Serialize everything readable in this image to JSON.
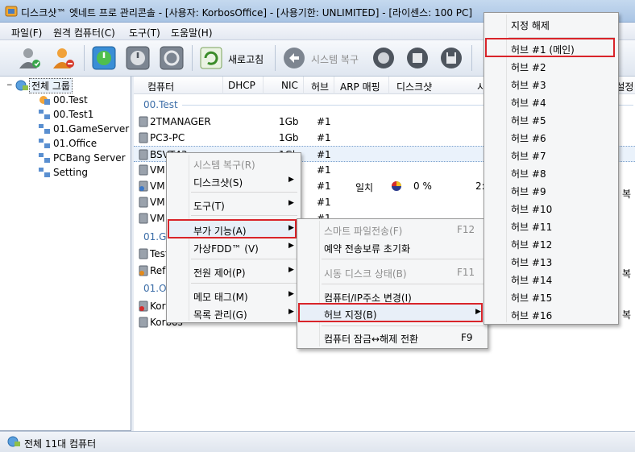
{
  "window": {
    "title": "디스크샷™ 엣네트 프로 관리콘솔 - [사용자: KorbosOffice] - [사용기한: UNLIMITED] - [라이센스: 100 PC]"
  },
  "menubar": [
    "파일(F)",
    "원격 컴퓨터(C)",
    "도구(T)",
    "도움말(H)"
  ],
  "toolbar": {
    "refresh_label": "새로고침",
    "restore_label": "시스템 복구"
  },
  "tree": {
    "root": "전체 그룹",
    "items": [
      "00.Test",
      "00.Test1",
      "01.GameServer",
      "01.Office",
      "PCBang Server",
      "Setting"
    ]
  },
  "columns": [
    "컴퓨터",
    "DHCP",
    "NIC",
    "허브",
    "ARP 매핑",
    "디스크샷",
    "시",
    "-설정"
  ],
  "groups": [
    {
      "label": "00.Test"
    },
    {
      "label": "01.Ga"
    },
    {
      "label": "01.Of"
    }
  ],
  "rows": [
    {
      "name": "2TMANAGER",
      "nic": "1Gb",
      "hub": "#1",
      "arp": "",
      "ds": ""
    },
    {
      "name": "PC3-PC",
      "nic": "1Gb",
      "hub": "#1",
      "arp": "",
      "ds": ""
    },
    {
      "name": "BSVT43",
      "nic": "1Gb",
      "hub": "#1",
      "arp": "",
      "ds": ""
    },
    {
      "name": "VM",
      "nic": "",
      "hub": "#1",
      "arp": "",
      "ds": ""
    },
    {
      "name": "VM",
      "nic": "",
      "hub": "#1",
      "arp": "일치",
      "ds": "0 %",
      "extra": "2:"
    },
    {
      "name": "VM",
      "nic": "",
      "hub": "#1",
      "arp": "",
      "ds": ""
    },
    {
      "name": "VM",
      "nic": "",
      "hub": "#1",
      "arp": "",
      "ds": ""
    },
    {
      "name": "Test",
      "nic": "",
      "hub": "",
      "arp": "",
      "ds": ""
    },
    {
      "name": "Ref",
      "nic": "",
      "hub": "",
      "arp": "",
      "ds": ""
    },
    {
      "name": "Kor",
      "nic": "",
      "hub": "",
      "arp": "",
      "ds": ""
    },
    {
      "name": "Korbos",
      "nic": "",
      "hub": "",
      "arp": "",
      "ds": ""
    }
  ],
  "right_fragments": [
    "복",
    "복",
    "복"
  ],
  "context_menu": {
    "items": [
      {
        "label": "시스템 복구(R)",
        "disabled": true,
        "submenu": false
      },
      {
        "label": "디스크샷(S)",
        "disabled": false,
        "submenu": true
      },
      {
        "label": "도구(T)",
        "disabled": false,
        "submenu": true
      },
      {
        "label": "부가 기능(A)",
        "disabled": false,
        "submenu": true
      },
      {
        "label": "가상FDD™ (V)",
        "disabled": false,
        "submenu": true
      },
      {
        "label": "전원 제어(P)",
        "disabled": false,
        "submenu": true
      },
      {
        "label": "메모 태그(M)",
        "disabled": false,
        "submenu": true
      },
      {
        "label": "목록 관리(G)",
        "disabled": false,
        "submenu": true
      }
    ]
  },
  "sub_menu": {
    "items": [
      {
        "label": "스마트 파일전송(F)",
        "shortcut": "F12",
        "disabled": true
      },
      {
        "label": "예약 전송보류 초기화",
        "shortcut": "",
        "disabled": false
      },
      {
        "label": "시동 디스크 상태(B)",
        "shortcut": "F11",
        "disabled": true
      },
      {
        "label": "컴퓨터/IP주소 변경(I)",
        "shortcut": "",
        "disabled": false
      },
      {
        "label": "허브 지정(B)",
        "shortcut": "",
        "disabled": false
      },
      {
        "label": "컴퓨터 잠금↔해제 전환",
        "shortcut": "F9",
        "disabled": false
      }
    ]
  },
  "hub_menu": {
    "items": [
      "지정 해제",
      "허브 #1 (메인)",
      "허브 #2",
      "허브 #3",
      "허브 #4",
      "허브 #5",
      "허브 #6",
      "허브 #7",
      "허브 #8",
      "허브 #9",
      "허브 #10",
      "허브 #11",
      "허브 #12",
      "허브 #13",
      "허브 #14",
      "허브 #15",
      "허브 #16"
    ]
  },
  "status": {
    "text": "전체 11대 컴퓨터"
  },
  "colors": {
    "highlight": "#d9242a",
    "group_text": "#3d6ea8",
    "title_bar": "#b8cfe9"
  }
}
